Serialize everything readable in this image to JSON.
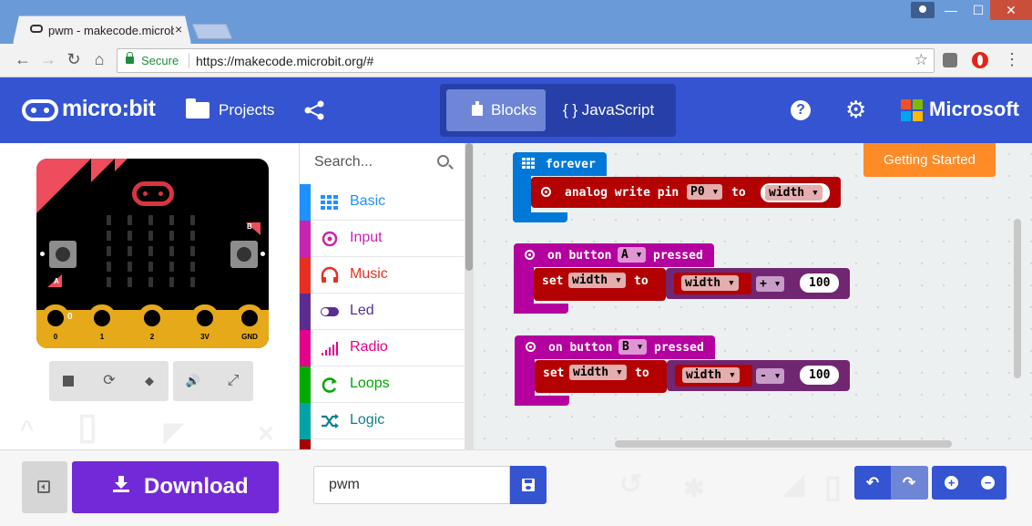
{
  "browser": {
    "tab_title": "pwm - makecode.microbit",
    "tab_close": "×",
    "secure_label": "Secure",
    "url": "https://makecode.microbit.org/#",
    "window_controls": {
      "minimize": "—",
      "maximize": "☐",
      "close": "✕"
    },
    "nav": {
      "back": "←",
      "forward": "→",
      "reload": "↻",
      "home": "⌂"
    },
    "bookmark_star": "☆",
    "menu_icon": "⋮"
  },
  "header": {
    "brand": "micro:bit",
    "projects_label": "Projects",
    "blocks_label": "Blocks",
    "javascript_label": "{ } JavaScript",
    "help_label": "?",
    "settings_label": "⚙",
    "microsoft_label": "Microsoft",
    "colors": {
      "header_bg": "#3454d1",
      "toggle_active": "#6f86d6"
    }
  },
  "simulator": {
    "button_a_label": "A",
    "button_b_label": "B",
    "pin0_value": "0",
    "pins": [
      "0",
      "1",
      "2",
      "3V",
      "GND"
    ],
    "controls": {
      "stop": "stop",
      "restart": "⟳",
      "debug": "◆",
      "mute": "🔊",
      "fullscreen": "⤢"
    }
  },
  "toolbox": {
    "search_placeholder": "Search...",
    "categories": [
      {
        "label": "Basic",
        "color": "#1e90ff",
        "icon": "grid-icon"
      },
      {
        "label": "Input",
        "color": "#c724b1",
        "icon": "target-icon"
      },
      {
        "label": "Music",
        "color": "#e63022",
        "icon": "headphones-icon"
      },
      {
        "label": "Led",
        "color": "#5c2d91",
        "icon": "toggle-icon"
      },
      {
        "label": "Radio",
        "color": "#e3008c",
        "icon": "signal-icon"
      },
      {
        "label": "Loops",
        "color": "#00aa00",
        "icon": "loop-icon"
      },
      {
        "label": "Logic",
        "color": "#00a4a6",
        "icon": "shuffle-icon"
      }
    ]
  },
  "workspace": {
    "getting_started_label": "Getting Started",
    "blocks": {
      "forever": {
        "label": "forever",
        "inner": {
          "text": "analog write pin",
          "pin": "P0",
          "to": "to",
          "var": "width"
        }
      },
      "on_button_a": {
        "prefix": "on button",
        "button": "A",
        "suffix": "pressed",
        "set": "set",
        "var": "width",
        "to": "to",
        "operand_var": "width",
        "op": "+",
        "value": "100"
      },
      "on_button_b": {
        "prefix": "on button",
        "button": "B",
        "suffix": "pressed",
        "set": "set",
        "var": "width",
        "to": "to",
        "operand_var": "width",
        "op": "-",
        "value": "100"
      }
    },
    "colors": {
      "loop_blue": "#0078d7",
      "input_magenta": "#b4009e",
      "pins_red": "#b30000",
      "math_purple": "#712672"
    }
  },
  "bottom": {
    "download_label": "Download",
    "project_name": "pwm",
    "undo_icon": "↶",
    "redo_icon": "↷",
    "zoom_in_icon": "+",
    "zoom_out_icon": "−"
  }
}
